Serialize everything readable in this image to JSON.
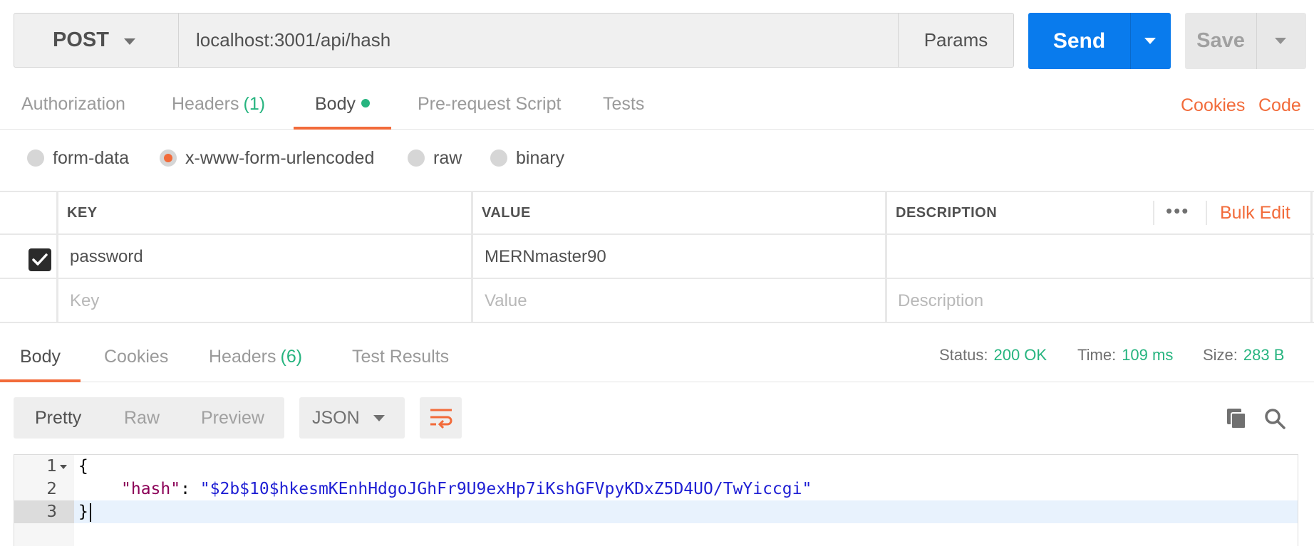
{
  "request": {
    "method": "POST",
    "url": "localhost:3001/api/hash",
    "params_label": "Params",
    "send_label": "Send",
    "save_label": "Save"
  },
  "request_tabs": [
    {
      "label": "Authorization",
      "count": ""
    },
    {
      "label": "Headers",
      "count": "(1)"
    },
    {
      "label": "Body",
      "count": ""
    },
    {
      "label": "Pre-request Script",
      "count": ""
    },
    {
      "label": "Tests",
      "count": ""
    }
  ],
  "links": {
    "cookies": "Cookies",
    "code": "Code"
  },
  "body_types": [
    "form-data",
    "x-www-form-urlencoded",
    "raw",
    "binary"
  ],
  "body_type_selected": "x-www-form-urlencoded",
  "kv_table": {
    "headers": {
      "key": "KEY",
      "value": "VALUE",
      "description": "DESCRIPTION"
    },
    "more_label": "•••",
    "bulk_edit_label": "Bulk Edit",
    "rows": [
      {
        "checked": true,
        "key": "password",
        "value": "MERNmaster90",
        "description": ""
      }
    ],
    "placeholders": {
      "key": "Key",
      "value": "Value",
      "description": "Description"
    }
  },
  "response_tabs": [
    {
      "label": "Body",
      "count": ""
    },
    {
      "label": "Cookies",
      "count": ""
    },
    {
      "label": "Headers",
      "count": "(6)"
    },
    {
      "label": "Test Results",
      "count": ""
    }
  ],
  "response_meta": {
    "status_label": "Status:",
    "status": "200 OK",
    "time_label": "Time:",
    "time": "109 ms",
    "size_label": "Size:",
    "size": "283 B"
  },
  "view_modes": [
    "Pretty",
    "Raw",
    "Preview"
  ],
  "view_mode_selected": "Pretty",
  "format": "JSON",
  "editor": {
    "line_numbers": [
      "1",
      "2",
      "3"
    ],
    "lines": {
      "open": "{",
      "key": "\"hash\"",
      "colon": ": ",
      "value": "\"$2b$10$hkesmKEnhHdgoJGhFr9U9exHp7iKshGFVpyKDxZ5D4UO/TwYiccgi\"",
      "close": "}"
    }
  },
  "colors": {
    "accent": "#f26b3a",
    "send": "#097bed",
    "success": "#26b47f"
  },
  "icons": [
    "chevron-down-icon",
    "checkmark-icon",
    "more-icon",
    "wrap-lines-icon",
    "copy-icon",
    "search-icon"
  ]
}
